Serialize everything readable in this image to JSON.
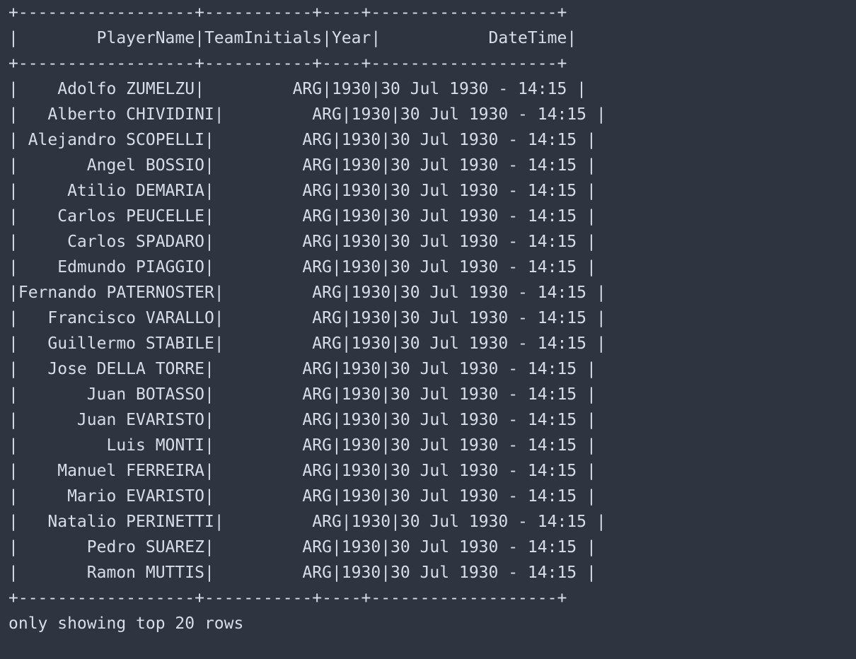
{
  "terminal": {
    "separator": "+------------------+-----------+----+-------------------+",
    "header": "|        PlayerName|TeamInitials|Year|           DateTime|",
    "rows": [
      "|    Adolfo ZUMELZU|         ARG|1930|30 Jul 1930 - 14:15 |",
      "|   Alberto CHIVIDINI|         ARG|1930|30 Jul 1930 - 14:15 |",
      "| Alejandro SCOPELLI|         ARG|1930|30 Jul 1930 - 14:15 |",
      "|       Angel BOSSIO|         ARG|1930|30 Jul 1930 - 14:15 |",
      "|     Atilio DEMARIA|         ARG|1930|30 Jul 1930 - 14:15 |",
      "|    Carlos PEUCELLE|         ARG|1930|30 Jul 1930 - 14:15 |",
      "|     Carlos SPADARO|         ARG|1930|30 Jul 1930 - 14:15 |",
      "|    Edmundo PIAGGIO|         ARG|1930|30 Jul 1930 - 14:15 |",
      "|Fernando PATERNOSTER|         ARG|1930|30 Jul 1930 - 14:15 |",
      "|   Francisco VARALLO|         ARG|1930|30 Jul 1930 - 14:15 |",
      "|   Guillermo STABILE|         ARG|1930|30 Jul 1930 - 14:15 |",
      "|   Jose DELLA TORRE|         ARG|1930|30 Jul 1930 - 14:15 |",
      "|       Juan BOTASSO|         ARG|1930|30 Jul 1930 - 14:15 |",
      "|      Juan EVARISTO|         ARG|1930|30 Jul 1930 - 14:15 |",
      "|         Luis MONTI|         ARG|1930|30 Jul 1930 - 14:15 |",
      "|    Manuel FERREIRA|         ARG|1930|30 Jul 1930 - 14:15 |",
      "|     Mario EVARISTO|         ARG|1930|30 Jul 1930 - 14:15 |",
      "|   Natalio PERINETTI|         ARG|1930|30 Jul 1930 - 14:15 |",
      "|       Pedro SUAREZ|         ARG|1930|30 Jul 1930 - 14:15 |",
      "|       Ramon MUTTIS|         ARG|1930|30 Jul 1930 - 14:15 |"
    ],
    "footer": "only showing top 20 rows"
  }
}
